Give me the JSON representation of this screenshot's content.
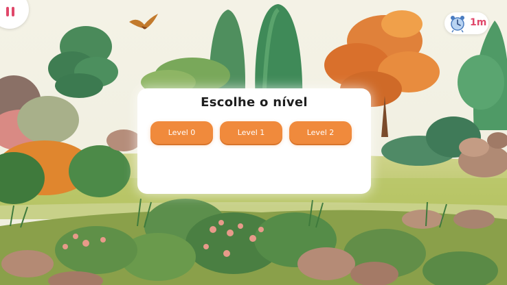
{
  "hud": {
    "pause_icon": "pause-icon",
    "timer_icon": "alarm-clock-icon",
    "timer_text": "1m",
    "accent_color": "#e0476a"
  },
  "dialog": {
    "title": "Escolhe o nível",
    "levels": [
      {
        "label": "Level 0"
      },
      {
        "label": "Level 1"
      },
      {
        "label": "Level 2"
      }
    ],
    "button_color": "#f08a3c"
  },
  "scene": {
    "description_icons": [
      "garden-background",
      "bird-icon"
    ]
  }
}
